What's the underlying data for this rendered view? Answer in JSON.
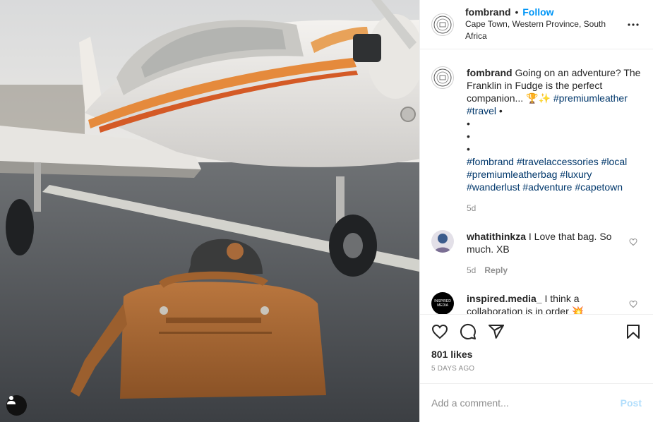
{
  "post": {
    "author": {
      "username": "fombrand",
      "follow_label": "Follow",
      "separator": "•",
      "location": "Cape Town, Western Province, South Africa"
    },
    "caption": {
      "username": "fombrand",
      "text": "Going on an adventure? The Franklin in Fudge is the perfect companion... 🏆✨",
      "tags_line1": "#premiumleather",
      "tags_line2": "#travel",
      "bullet": "•",
      "tags_block": [
        "#fombrand",
        "#travelaccessories",
        "#local",
        "#premiumleatherbag",
        "#luxury",
        "#wanderlust",
        "#adventure",
        "#capetown"
      ],
      "age": "5d"
    },
    "comments": [
      {
        "username": "whatithinkza",
        "text": "I Love that bag. So much. XB",
        "age": "5d",
        "reply_label": "Reply"
      },
      {
        "username": "inspired.media_",
        "text": "I think a collaboration is in order 💥",
        "avatar_text": "INSPIRED MEDIA"
      }
    ],
    "likes": "801 likes",
    "posted": "5 DAYS AGO",
    "comment_input": {
      "placeholder": "Add a comment...",
      "post_label": "Post"
    },
    "icons": {
      "like": "heart-icon",
      "comment": "comment-icon",
      "share": "send-icon",
      "save": "bookmark-icon",
      "more": "more-dots-icon",
      "tag": "user-tag-icon"
    },
    "colors": {
      "link": "#0095f6",
      "hashtag": "#00376b",
      "muted": "#8e8e8e"
    }
  }
}
